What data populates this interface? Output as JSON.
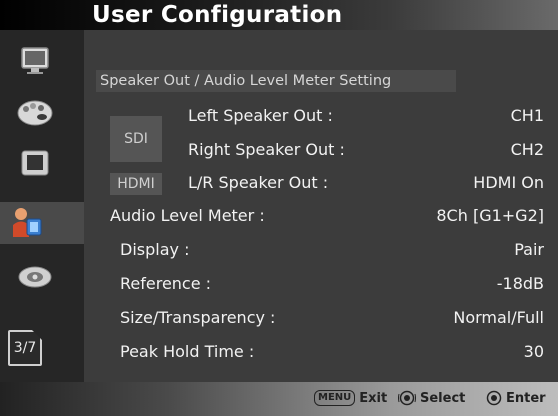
{
  "header": {
    "title": "User Configuration"
  },
  "sidebar": {
    "icons": [
      "monitor-icon",
      "palette-icon",
      "display-frame-icon",
      "user-config-icon",
      "eye-icon"
    ],
    "page_indicator": "3/7"
  },
  "section": {
    "title": "Speaker Out / Audio Level Meter Setting"
  },
  "sdi": {
    "tag": "SDI",
    "left_label": "Left Speaker Out :",
    "left_value": "CH1",
    "right_label": "Right Speaker Out :",
    "right_value": "CH2"
  },
  "hdmi": {
    "tag": "HDMI",
    "lr_label": "L/R Speaker Out :",
    "lr_value": "HDMI On"
  },
  "meter": {
    "label": "Audio Level Meter :",
    "value": "8Ch [G1+G2]",
    "items": [
      {
        "label": "Display :",
        "value": "Pair"
      },
      {
        "label": "Reference :",
        "value": "-18dB"
      },
      {
        "label": "Size/Transparency :",
        "value": "Normal/Full"
      },
      {
        "label": "Peak Hold Time :",
        "value": "30"
      }
    ]
  },
  "footer": {
    "menu_key": "MENU",
    "exit_label": "Exit",
    "select_label": "Select",
    "enter_label": "Enter"
  },
  "colors": {
    "background": "#3c3c3c",
    "sidebar": "#262626",
    "text": "#f2f2f2",
    "tag_bg": "#555555"
  }
}
